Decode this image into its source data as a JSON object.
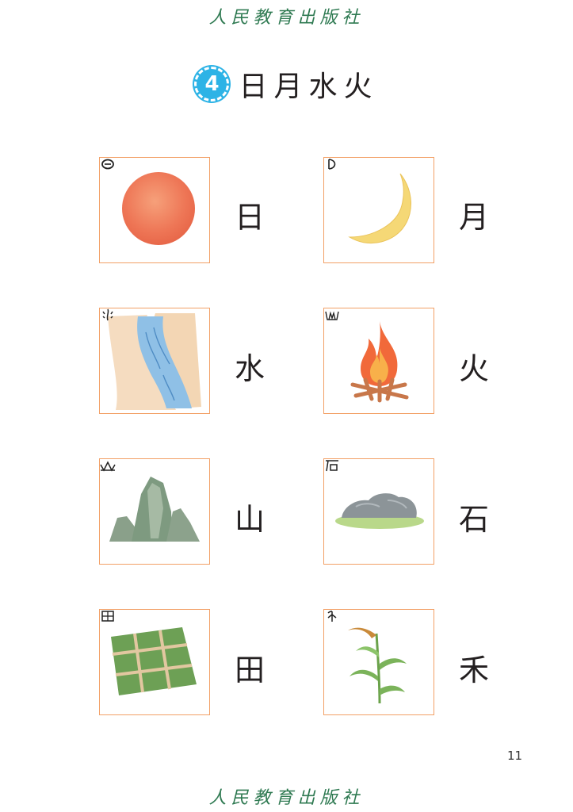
{
  "publisher": "人民教育出版社",
  "lesson": {
    "number": "4",
    "title": "日月水火"
  },
  "items": [
    {
      "char": "日",
      "picture": "sun",
      "glyph_icon": "oracle-sun-icon"
    },
    {
      "char": "月",
      "picture": "crescent-moon",
      "glyph_icon": "oracle-moon-icon"
    },
    {
      "char": "水",
      "picture": "river",
      "glyph_icon": "oracle-water-icon"
    },
    {
      "char": "火",
      "picture": "campfire",
      "glyph_icon": "oracle-fire-icon"
    },
    {
      "char": "山",
      "picture": "mountains",
      "glyph_icon": "oracle-mountain-icon"
    },
    {
      "char": "石",
      "picture": "rock",
      "glyph_icon": "oracle-stone-icon"
    },
    {
      "char": "田",
      "picture": "field",
      "glyph_icon": "oracle-field-icon"
    },
    {
      "char": "禾",
      "picture": "grain-plant",
      "glyph_icon": "oracle-grain-icon"
    }
  ],
  "page_number": "11",
  "colors": {
    "card_border": "#f2a066",
    "lesson_badge": "#2db3e6",
    "publisher": "#2f7a52"
  }
}
